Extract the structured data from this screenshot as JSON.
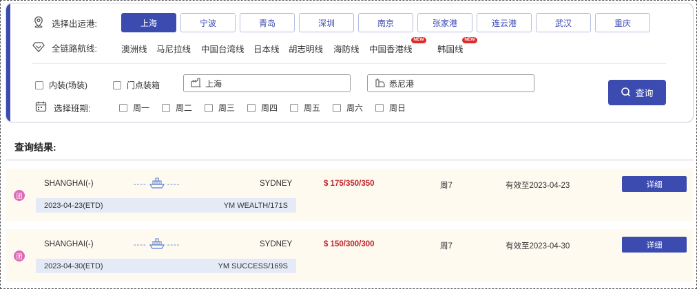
{
  "search": {
    "port_label": "选择出运港:",
    "ports": [
      {
        "label": "上海",
        "active": true
      },
      {
        "label": "宁波",
        "active": false
      },
      {
        "label": "青岛",
        "active": false
      },
      {
        "label": "深圳",
        "active": false
      },
      {
        "label": "南京",
        "active": false
      },
      {
        "label": "张家港",
        "active": false
      },
      {
        "label": "连云港",
        "active": false
      },
      {
        "label": "武汉",
        "active": false
      },
      {
        "label": "重庆",
        "active": false
      }
    ],
    "route_label": "全链路航线:",
    "routes": [
      {
        "label": "澳洲线",
        "new": false
      },
      {
        "label": "马尼拉线",
        "new": false
      },
      {
        "label": "中国台湾线",
        "new": false
      },
      {
        "label": "日本线",
        "new": false
      },
      {
        "label": "胡志明线",
        "new": false
      },
      {
        "label": "海防线",
        "new": false
      },
      {
        "label": "中国香港线",
        "new": true
      },
      {
        "label": "韩国线",
        "new": true
      }
    ],
    "new_badge": "NEW",
    "option_inner": "内装(场装)",
    "option_door": "门点装箱",
    "origin_value": "上海",
    "destination_value": "悉尼港",
    "schedule_label": "选择班期:",
    "weekdays": [
      "周一",
      "周二",
      "周三",
      "周四",
      "周五",
      "周六",
      "周日"
    ],
    "search_button": "查询"
  },
  "results": {
    "title": "查询结果:",
    "detail_label": "详细",
    "badge": "团",
    "items": [
      {
        "origin": "SHANGHAI(-)",
        "destination": "SYDNEY",
        "price": "$ 175/350/350",
        "day": "周7",
        "valid": "有效至2023-04-23",
        "etd": "2023-04-23(ETD)",
        "vessel": "YM WEALTH/171S"
      },
      {
        "origin": "SHANGHAI(-)",
        "destination": "SYDNEY",
        "price": "$ 150/300/300",
        "day": "周7",
        "valid": "有效至2023-04-30",
        "etd": "2023-04-30(ETD)",
        "vessel": "YM SUCCESS/169S"
      }
    ]
  },
  "colors": {
    "accent": "#3b4bb0",
    "price": "#c0262d",
    "row_bg": "#fffaf0",
    "sub_bg": "#e5ebf6",
    "badge": "#e06ab8",
    "new_badge": "#e02a2a"
  },
  "icons": [
    "location-pin-icon",
    "diamond-route-icon",
    "calendar-icon",
    "factory-icon",
    "port-crane-icon",
    "search-icon",
    "ship-icon"
  ]
}
